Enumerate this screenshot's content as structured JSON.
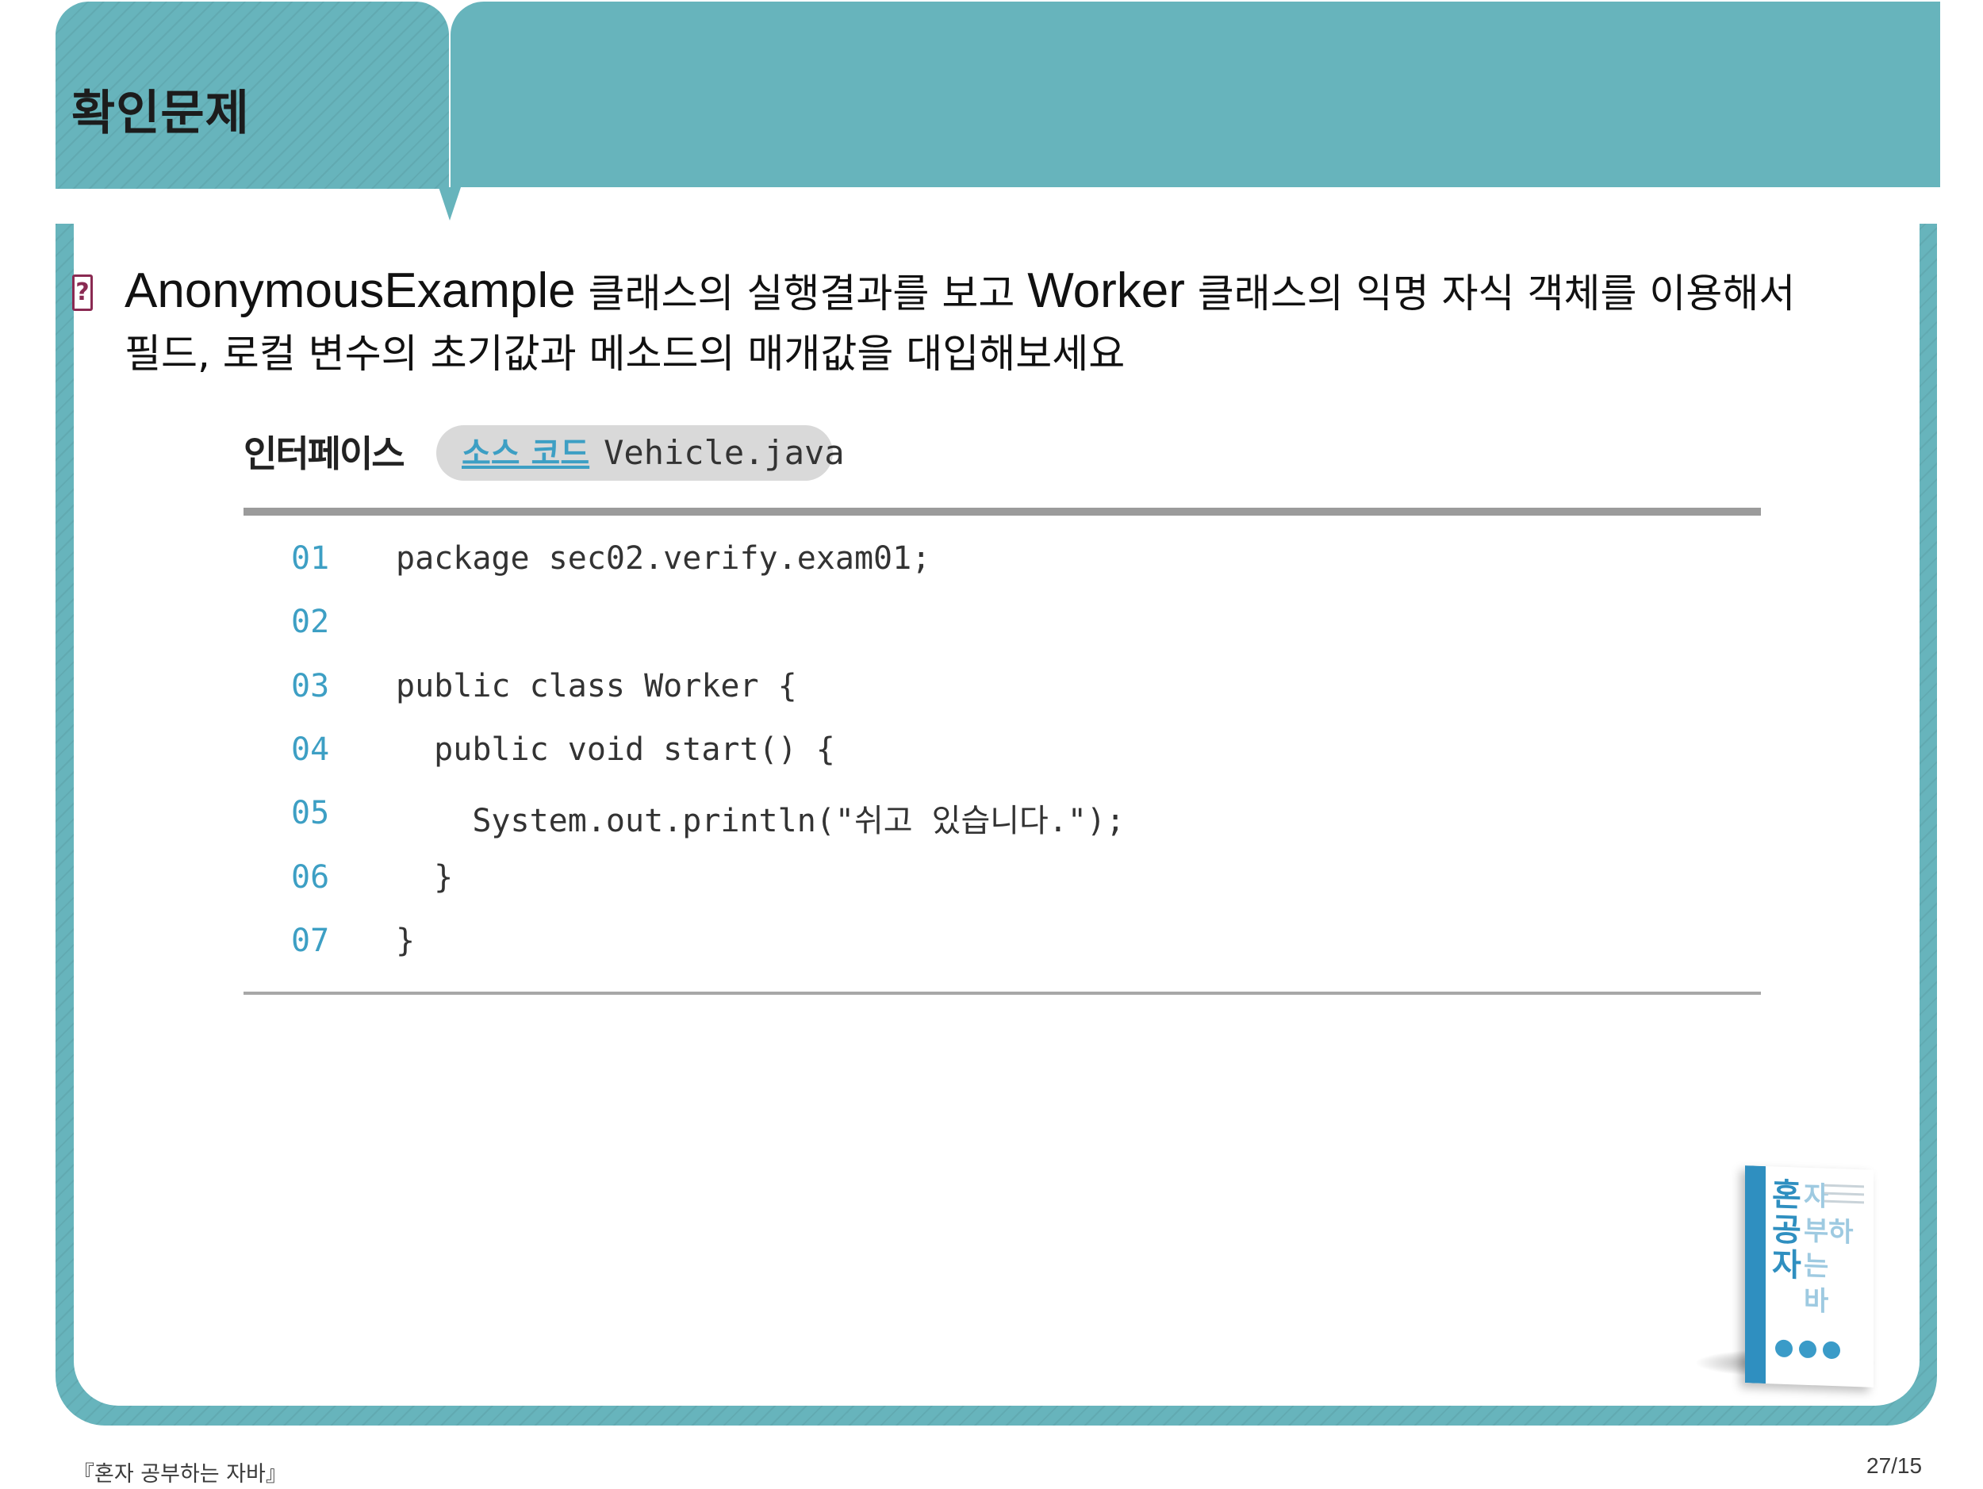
{
  "header": {
    "title": "확인문제"
  },
  "question": {
    "line1_word1": "AnonymousExample",
    "line1_text1": " 클래스의 실행결과를 보고 ",
    "line1_word2": "Worker",
    "line1_text2": " 클래스의 익명 자식 객체를 이용해서",
    "line2": "필드, 로컬 변수의 초기값과 메소드의 매개값을 대입해보세요"
  },
  "code_listing": {
    "header_label": "인터페이스",
    "tag_label": "소스 코드",
    "file_name": "Vehicle.java",
    "rows": [
      {
        "num": "01",
        "text": "package sec02.verify.exam01;"
      },
      {
        "num": "02",
        "text": ""
      },
      {
        "num": "03",
        "text": "public class Worker {"
      },
      {
        "num": "04",
        "text": "  public void start() {"
      },
      {
        "num": "05",
        "text": "    System.out.println(\"쉬고 있습니다.\");"
      },
      {
        "num": "06",
        "text": "  }"
      },
      {
        "num": "07",
        "text": "}"
      }
    ]
  },
  "cover": {
    "title_a": "혼공자",
    "title_b": "자부하바는",
    "spine_text": "혼자 공부하는 자바"
  },
  "footer": {
    "book_title": "『혼자 공부하는 자바』",
    "page_number": "27/15"
  },
  "colors": {
    "header_teal": "#67b4bc",
    "code_number_blue": "#3d9fc4",
    "question_icon": "#8a2a52"
  },
  "icons": {
    "question": "question-mark-icon"
  }
}
